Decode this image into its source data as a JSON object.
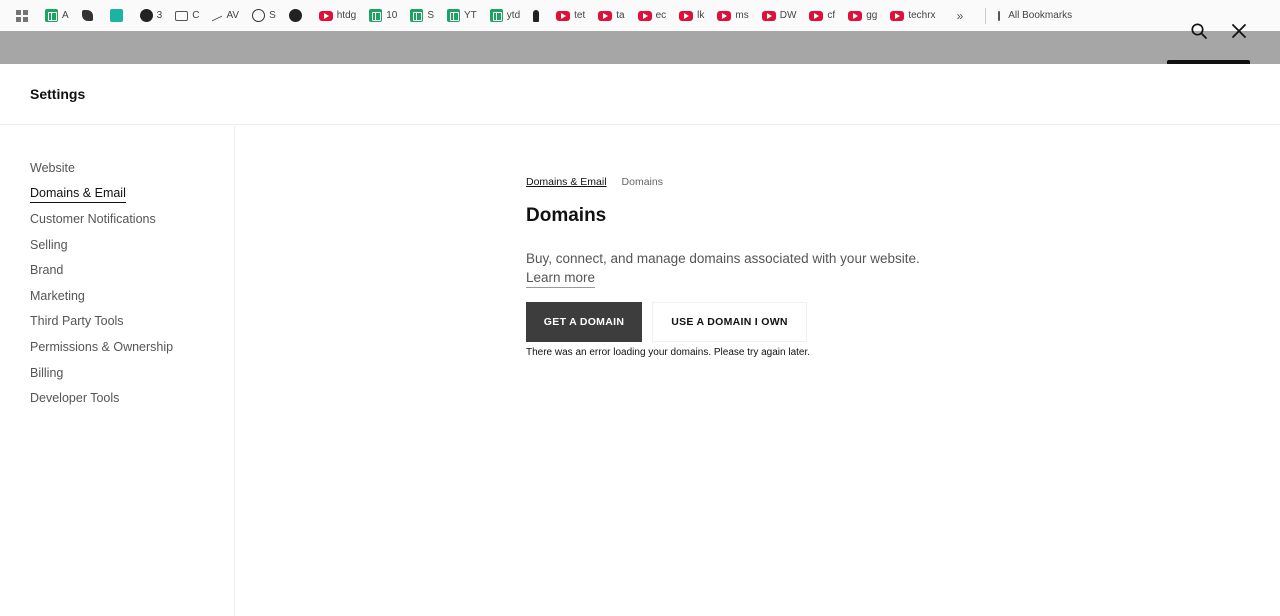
{
  "bookmarks": {
    "items": [
      {
        "label": "",
        "icon": "apps-grid-icon"
      },
      {
        "label": "A",
        "icon": "sheets-icon"
      },
      {
        "label": "",
        "icon": "puzzle-icon"
      },
      {
        "label": "",
        "icon": "teal-app-icon"
      },
      {
        "label": "3",
        "icon": "threads-icon"
      },
      {
        "label": "C",
        "icon": "folder-icon"
      },
      {
        "label": "AV",
        "icon": "trend-icon"
      },
      {
        "label": "S",
        "icon": "globe-icon"
      },
      {
        "label": "",
        "icon": "github-icon"
      },
      {
        "label": "htdg",
        "icon": "youtube-icon"
      },
      {
        "label": "10",
        "icon": "sheets-icon"
      },
      {
        "label": "S",
        "icon": "sheets-icon"
      },
      {
        "label": "YT",
        "icon": "sheets-icon"
      },
      {
        "label": "ytd",
        "icon": "sheets-icon"
      },
      {
        "label": "",
        "icon": "pin-icon"
      },
      {
        "label": "tet",
        "icon": "youtube-icon"
      },
      {
        "label": "ta",
        "icon": "youtube-icon"
      },
      {
        "label": "ec",
        "icon": "youtube-icon"
      },
      {
        "label": "lk",
        "icon": "youtube-icon"
      },
      {
        "label": "ms",
        "icon": "youtube-icon"
      },
      {
        "label": "DW",
        "icon": "youtube-icon"
      },
      {
        "label": "cf",
        "icon": "youtube-icon"
      },
      {
        "label": "gg",
        "icon": "youtube-icon"
      },
      {
        "label": "techrx",
        "icon": "youtube-icon"
      }
    ],
    "more": "»",
    "all_bookmarks": "All Bookmarks"
  },
  "header": {
    "title": "Settings"
  },
  "sidebar": {
    "items": [
      {
        "label": "Website",
        "active": false
      },
      {
        "label": "Domains & Email",
        "active": true
      },
      {
        "label": "Customer Notifications",
        "active": false
      },
      {
        "label": "Selling",
        "active": false
      },
      {
        "label": "Brand",
        "active": false
      },
      {
        "label": "Marketing",
        "active": false
      },
      {
        "label": "Third Party Tools",
        "active": false
      },
      {
        "label": "Permissions & Ownership",
        "active": false
      },
      {
        "label": "Billing",
        "active": false
      },
      {
        "label": "Developer Tools",
        "active": false
      }
    ]
  },
  "main": {
    "breadcrumb": {
      "parent": "Domains & Email",
      "current": "Domains"
    },
    "title": "Domains",
    "description": "Buy, connect, and manage domains associated with your website.",
    "learn_more": "Learn more",
    "get_domain_label": "GET A DOMAIN",
    "use_domain_label": "USE A DOMAIN I OWN",
    "error_message": "There was an error loading your domains. Please try again later."
  },
  "colors": {
    "primary_button": "#3d3d3d",
    "overlay_band": "#a6a6a6"
  }
}
